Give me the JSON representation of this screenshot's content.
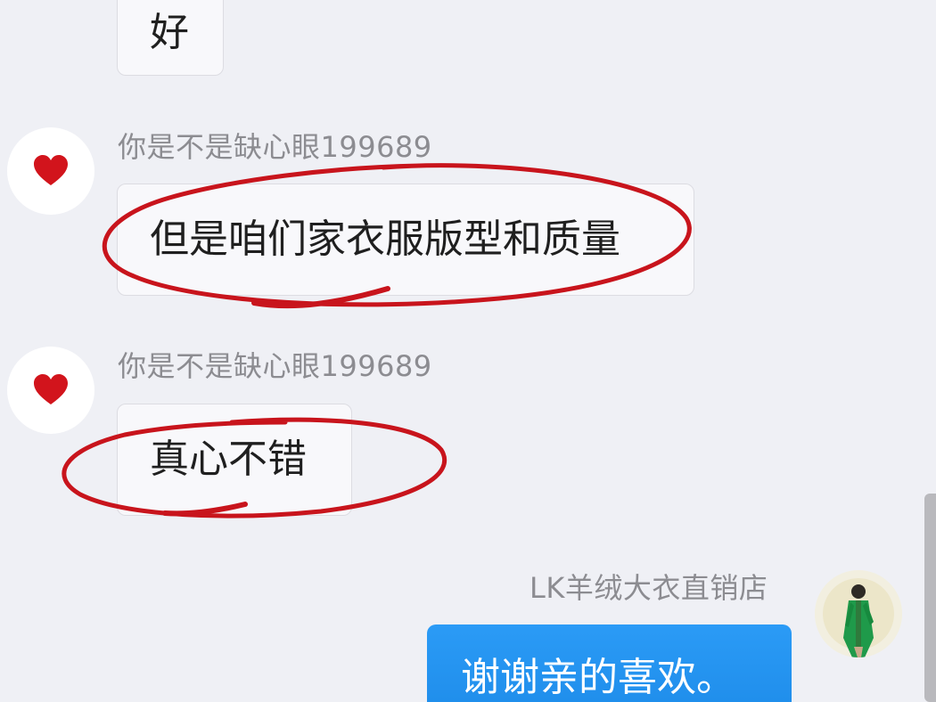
{
  "messages": [
    {
      "text": "好"
    },
    {
      "sender": "你是不是缺心眼199689",
      "text": "但是咱们家衣服版型和质量"
    },
    {
      "sender": "你是不是缺心眼199689",
      "text": "真心不错"
    },
    {
      "sender": "LK羊绒大衣直销店",
      "text": "谢谢亲的喜欢。"
    }
  ],
  "colors": {
    "background": "#eff0f5",
    "incoming_bubble": "#f8f8fb",
    "outgoing_bubble": "#1f8ff0",
    "annotation": "#c8141c"
  },
  "icons": {
    "user_avatar": "heart-icon",
    "shop_avatar": "model-photo"
  }
}
